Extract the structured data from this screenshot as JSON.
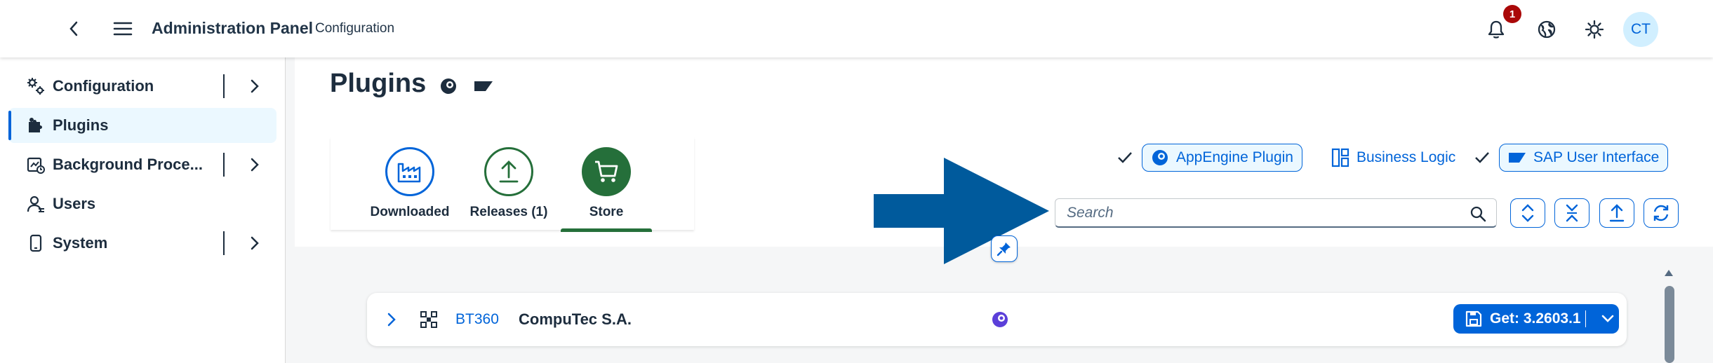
{
  "shell": {
    "title": "Administration Panel",
    "subtitle": "Configuration",
    "notification_count": "1",
    "avatar_initials": "CT"
  },
  "sidebar": {
    "items": [
      {
        "label": "Configuration",
        "icon": "gears-icon",
        "has_children": true,
        "active": false
      },
      {
        "label": "Plugins",
        "icon": "puzzle-icon",
        "has_children": false,
        "active": true
      },
      {
        "label": "Background Proce...",
        "icon": "process-icon",
        "has_children": true,
        "active": false
      },
      {
        "label": "Users",
        "icon": "user-icon",
        "has_children": false,
        "active": false
      },
      {
        "label": "System",
        "icon": "device-icon",
        "has_children": true,
        "active": false
      }
    ]
  },
  "page": {
    "title": "Plugins"
  },
  "tabs": [
    {
      "label": "Downloaded",
      "icon": "factory-icon",
      "color": "#0064d9"
    },
    {
      "label": "Releases (1)",
      "icon": "upload-icon",
      "color": "#256f3a"
    },
    {
      "label": "Store",
      "icon": "cart-icon",
      "color": "#256f3a",
      "selected": true
    }
  ],
  "filters": {
    "toggles": [
      {
        "label": "AppEngine Plugin",
        "checked": true
      },
      {
        "label": "Business Logic",
        "checked": false
      },
      {
        "label": "SAP User Interface",
        "checked": true
      }
    ]
  },
  "search": {
    "placeholder": "Search",
    "value": ""
  },
  "list": {
    "rows": [
      {
        "id": "BT360",
        "vendor": "CompuTec S.A.",
        "action_label": "Get: 3.2603.1"
      }
    ]
  },
  "colors": {
    "accent": "#0064d9",
    "positive": "#256f3a",
    "badge": "#aa0808",
    "arrow": "#005a9c"
  }
}
